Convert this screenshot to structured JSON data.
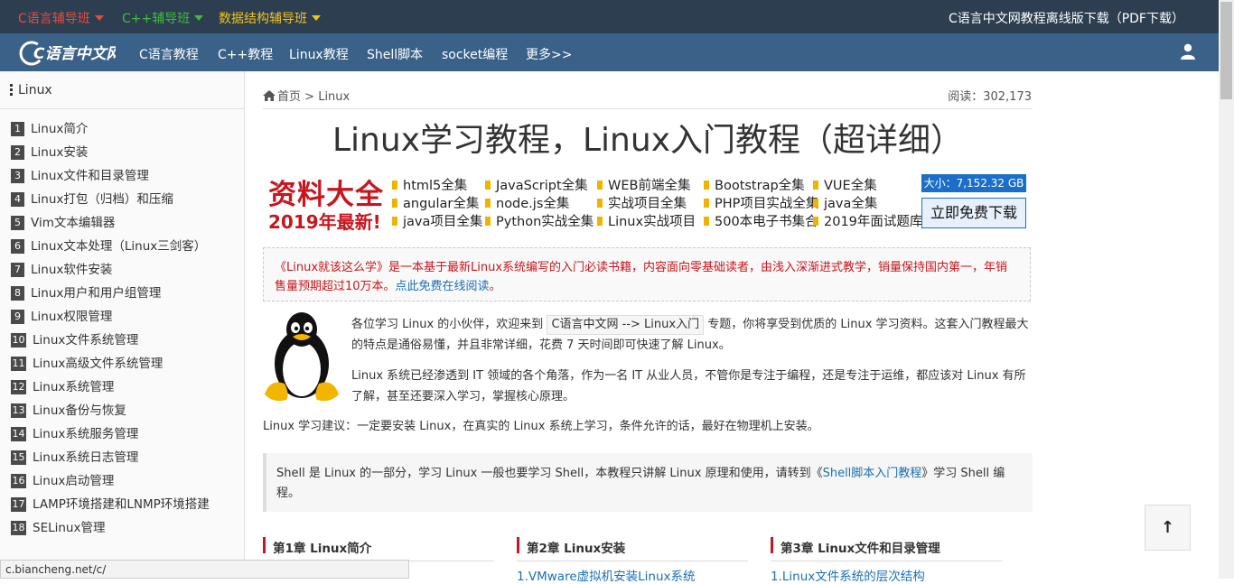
{
  "topbar": {
    "links": [
      {
        "label": "C语言辅导班",
        "color": "#e74c3c"
      },
      {
        "label": "C++辅导班",
        "color": "#3bbf3b"
      },
      {
        "label": "数据结构辅导班",
        "color": "#f0c419"
      }
    ],
    "download_label": "C语言中文网教程离线版下载（PDF下载）"
  },
  "nav": {
    "logo_text": "C语言中文网",
    "items": [
      "C语言教程",
      "C++教程",
      "Linux教程",
      "Shell脚本",
      "socket编程",
      "更多>>"
    ]
  },
  "sidebar": {
    "title": "Linux",
    "items": [
      {
        "num": "1",
        "label": "Linux简介"
      },
      {
        "num": "2",
        "label": "Linux安装"
      },
      {
        "num": "3",
        "label": "Linux文件和目录管理"
      },
      {
        "num": "4",
        "label": "Linux打包（归档）和压缩"
      },
      {
        "num": "5",
        "label": "Vim文本编辑器"
      },
      {
        "num": "6",
        "label": "Linux文本处理（Linux三剑客）"
      },
      {
        "num": "7",
        "label": "Linux软件安装"
      },
      {
        "num": "8",
        "label": "Linux用户和用户组管理"
      },
      {
        "num": "9",
        "label": "Linux权限管理"
      },
      {
        "num": "10",
        "label": "Linux文件系统管理"
      },
      {
        "num": "11",
        "label": "Linux高级文件系统管理"
      },
      {
        "num": "12",
        "label": "Linux系统管理"
      },
      {
        "num": "13",
        "label": "Linux备份与恢复"
      },
      {
        "num": "14",
        "label": "Linux系统服务管理"
      },
      {
        "num": "15",
        "label": "Linux系统日志管理"
      },
      {
        "num": "16",
        "label": "Linux启动管理"
      },
      {
        "num": "17",
        "label": "LAMP环境搭建和LNMP环境搭建"
      },
      {
        "num": "18",
        "label": "SELinux管理"
      }
    ]
  },
  "statusbar": "c.biancheng.net/c/",
  "breadcrumb": {
    "home": "首页",
    "sep": ">",
    "current": "Linux"
  },
  "reads": "阅读：302,173",
  "title": "Linux学习教程，Linux入门教程（超详细）",
  "ad": {
    "headline": "资料大全",
    "year": "2019年最新!",
    "links": [
      "html5全集",
      "JavaScript全集",
      "WEB前端全集",
      "Bootstrap全集",
      "VUE全集",
      "angular全集",
      "node.js全集",
      "实战项目全集",
      "PHP项目实战全集",
      "java全集",
      "java项目全集",
      "Python实战全集",
      "Linux实战项目",
      "500本电子书集合",
      "2019年面试题库"
    ],
    "size": "大小：7,152.32 GB",
    "download": "立即免费下载"
  },
  "notice": {
    "text": "《Linux就该这么学》是一本基于最新Linux系统编写的入门必读书籍，内容面向零基础读者，由浅入深渐进式教学，销量保持国内第一，年销售量预期超过10万本。",
    "link": "点此免费在线阅读",
    "end": "。"
  },
  "intro": {
    "p1_before": "各位学习 Linux 的小伙伴，欢迎来到",
    "p1_code": "C语言中文网 --> Linux入门",
    "p1_after": "专题，你将享受到优质的 Linux 学习资料。这套入门教程最大的特点是通俗易懂，并且非常详细，花费 7 天时间即可快速了解 Linux。",
    "p2": "Linux 系统已经渗透到 IT 领域的各个角落，作为一名 IT 从业人员，不管你是专注于编程，还是专注于运维，都应该对 Linux 有所了解，甚至还要深入学习，掌握核心原理。",
    "p3": "Linux 学习建议：一定要安装 Linux，在真实的 Linux 系统上学习，条件允许的话，最好在物理机上安装。"
  },
  "quote": {
    "before": "Shell 是 Linux 的一部分，学习 Linux 一般也要学习 Shell，本教程只讲解 Linux 原理和使用，请转到《",
    "link": "Shell脚本入门教程",
    "after": "》学习 Shell 编程。"
  },
  "chapters": [
    {
      "title": "第1章 Linux简介",
      "first": ""
    },
    {
      "title": "第2章 Linux安装",
      "first": "1.VMware虚拟机安装Linux系统"
    },
    {
      "title": "第3章 Linux文件和目录管理",
      "first": "1.Linux文件系统的层次结构"
    }
  ],
  "to_top": "↑"
}
